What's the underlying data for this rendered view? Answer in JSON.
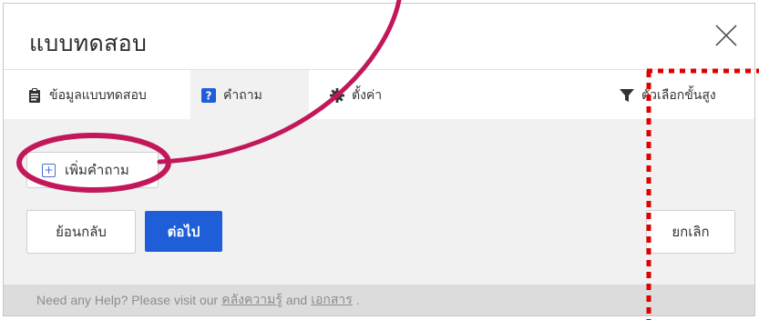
{
  "dialog": {
    "title": "แบบทดสอบ",
    "close_icon": "close-icon"
  },
  "tabs": [
    {
      "label": "ข้อมูลแบบทดสอบ",
      "icon": "clipboard-icon",
      "active": false
    },
    {
      "label": "คำถาม",
      "icon": "question-icon",
      "active": true
    },
    {
      "label": "ตั้งค่า",
      "icon": "gear-icon",
      "active": false
    },
    {
      "label": "ตัวเลือกขั้นสูง",
      "icon": "filter-icon",
      "active": false
    }
  ],
  "content": {
    "add_question_label": "เพิ่มคำถาม",
    "back_label": "ย้อนกลับ",
    "next_label": "ต่อไป",
    "cancel_label": "ยกเลิก"
  },
  "footer": {
    "prefix": "Need any Help? Please visit our",
    "link1": "คลังความรู้",
    "middle": "and",
    "link2": "เอกสาร",
    "suffix": "."
  },
  "colors": {
    "primary": "#1e5ed8",
    "annotation": "#c2185b",
    "annotation_dotted": "#e00000",
    "footer_bg": "#dcdcdc",
    "content_bg": "#f1f1f1"
  }
}
